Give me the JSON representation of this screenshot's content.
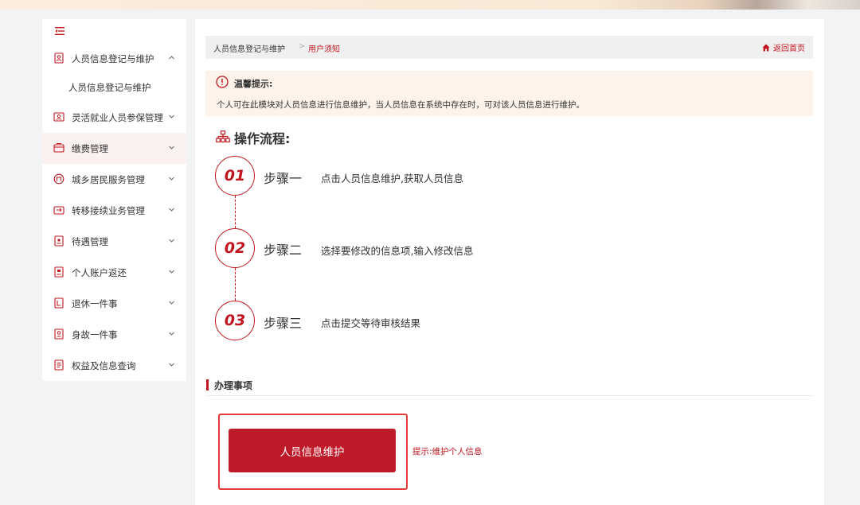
{
  "sidebar": {
    "items": [
      {
        "label": "人员信息登记与维护",
        "icon": "user-card-icon",
        "expanded": true
      },
      {
        "label": "灵活就业人员参保管理",
        "icon": "id-card-icon"
      },
      {
        "label": "缴费管理",
        "icon": "payment-icon",
        "active": true
      },
      {
        "label": "城乡居民服务管理",
        "icon": "resident-icon"
      },
      {
        "label": "转移接续业务管理",
        "icon": "transfer-icon"
      },
      {
        "label": "待遇管理",
        "icon": "benefit-icon"
      },
      {
        "label": "个人账户返还",
        "icon": "account-icon"
      },
      {
        "label": "退休一件事",
        "icon": "retire-icon"
      },
      {
        "label": "身故一件事",
        "icon": "deceased-icon"
      },
      {
        "label": "权益及信息查询",
        "icon": "query-icon"
      }
    ],
    "sub_item": "人员信息登记与维护"
  },
  "breadcrumb": {
    "home": "人员信息登记与维护",
    "separator": ">",
    "current": "用户须知",
    "back_label": "返回首页"
  },
  "notice": {
    "title": "温馨提示:",
    "text": "个人可在此模块对人员信息进行信息维护，当人员信息在系统中存在时，可对该人员信息进行维护。"
  },
  "flow": {
    "title": "操作流程:",
    "steps": [
      {
        "num": "01",
        "name": "步骤一",
        "desc": "点击人员信息维护,获取人员信息"
      },
      {
        "num": "02",
        "name": "步骤二",
        "desc": "选择要修改的信息项,输入修改信息"
      },
      {
        "num": "03",
        "name": "步骤三",
        "desc": "点击提交等待审核结果"
      }
    ]
  },
  "section": {
    "title": "办理事项",
    "button_label": "人员信息维护",
    "hint": "提示:维护个人信息"
  },
  "colors": {
    "accent": "#c0161f",
    "button": "#be1a2a",
    "notice_bg": "#fdf3ea",
    "active_bg": "#fbf1f1"
  }
}
